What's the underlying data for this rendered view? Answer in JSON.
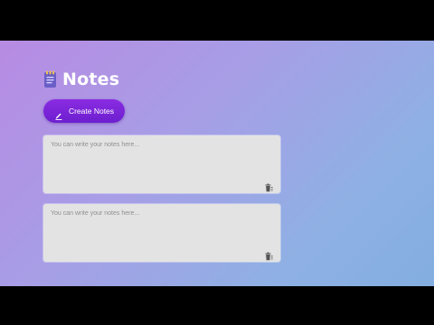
{
  "app": {
    "title": "Notes",
    "create_button_label": "Create Notes",
    "icons": {
      "title_icon": "notepad-icon",
      "create_icon": "pencil-icon",
      "delete_icon": "trash-icon"
    },
    "colors": {
      "accent": "#7a23d9",
      "note_background": "#e3e3e3",
      "gradient_start": "#b78be3",
      "gradient_end": "#83aee0"
    }
  },
  "notes": [
    {
      "placeholder": "You can write your notes here..."
    },
    {
      "placeholder": "You can write your notes here..."
    }
  ]
}
